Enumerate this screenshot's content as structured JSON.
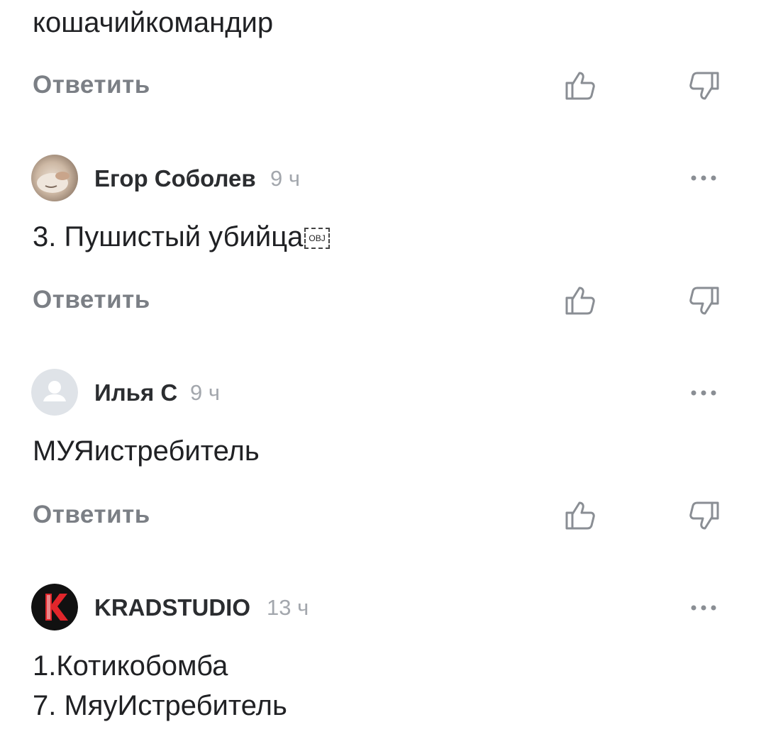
{
  "comments": [
    {
      "text": "кошачийкомандир",
      "reply_label": "Ответить"
    },
    {
      "author": "Егор Соболев",
      "time": "9 ч",
      "text": "3. Пушистый убийца",
      "object_glyph": "OBJ",
      "reply_label": "Ответить"
    },
    {
      "author": "Илья С",
      "time": "9 ч",
      "text": "МУЯистребитель",
      "reply_label": "Ответить"
    },
    {
      "author": "KRADSTUDIO",
      "time": "13 ч",
      "text": "1.Котикобомба\n7. МяуИстребитель"
    }
  ],
  "icons": {
    "like": "thumb-up-icon",
    "dislike": "thumb-down-icon",
    "more": "more-dots-icon"
  },
  "colors": {
    "text": "#202124",
    "secondary": "#7b7f85",
    "time": "#a3a7ad",
    "icon": "#8a8e94"
  }
}
